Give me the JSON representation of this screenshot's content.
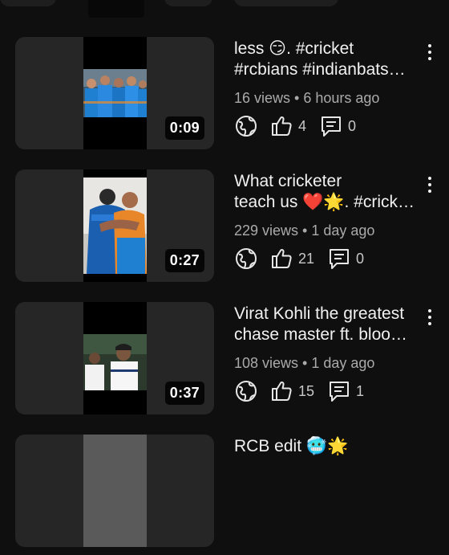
{
  "videos": [
    {
      "title_line1": "less 😏. #cricket",
      "title_line2": "#rcbians #indianbats…",
      "meta": "16 views • 6 hours ago",
      "likes": "4",
      "comments": "0",
      "duration": "0:09",
      "visibility_icon": "globe-icon"
    },
    {
      "title_line1": "What cricketer",
      "title_line2": "teach us ❤️🌟. #crick…",
      "meta": "229 views • 1 day ago",
      "likes": "21",
      "comments": "0",
      "duration": "0:27",
      "visibility_icon": "globe-icon"
    },
    {
      "title_line1": "Virat Kohli the greatest",
      "title_line2": "chase master ft. bloo…",
      "meta": "108 views • 1 day ago",
      "likes": "15",
      "comments": "1",
      "duration": "0:37",
      "visibility_icon": "globe-icon"
    },
    {
      "title_line1": "RCB edit 🥶🌟",
      "title_line2": ""
    }
  ],
  "colors": {
    "background": "#0f0f0f",
    "thumb_bg": "#262626",
    "secondary_text": "#aaaaaa",
    "india_blue": "#1f7fd0"
  }
}
